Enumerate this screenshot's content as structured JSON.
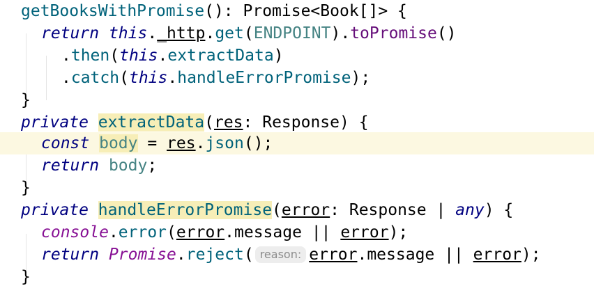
{
  "editor": {
    "lines": [
      {
        "tokens": [
          {
            "text": "getBooksWithPromise",
            "cls": "fn"
          },
          {
            "text": "(): Promise<Book[]> {",
            "cls": "plain"
          }
        ]
      },
      {
        "tokens": [
          {
            "text": "return",
            "cls": "kw"
          },
          {
            "text": " ",
            "cls": "plain"
          },
          {
            "text": "this",
            "cls": "kw"
          },
          {
            "text": ".",
            "cls": "plain"
          },
          {
            "text": "_http",
            "cls": "prop-under"
          },
          {
            "text": ".",
            "cls": "plain"
          },
          {
            "text": "get",
            "cls": "method"
          },
          {
            "text": "(",
            "cls": "plain"
          },
          {
            "text": "ENDPOINT",
            "cls": "const-name"
          },
          {
            "text": ").",
            "cls": "plain"
          },
          {
            "text": "toPromise",
            "cls": "prop"
          },
          {
            "text": "()",
            "cls": "plain"
          }
        ]
      },
      {
        "tokens": [
          {
            "text": ".",
            "cls": "plain"
          },
          {
            "text": "then",
            "cls": "method"
          },
          {
            "text": "(",
            "cls": "plain"
          },
          {
            "text": "this",
            "cls": "kw"
          },
          {
            "text": ".",
            "cls": "plain"
          },
          {
            "text": "extractData",
            "cls": "method"
          },
          {
            "text": ")",
            "cls": "plain"
          }
        ]
      },
      {
        "tokens": [
          {
            "text": ".",
            "cls": "plain"
          },
          {
            "text": "catch",
            "cls": "method"
          },
          {
            "text": "(",
            "cls": "plain"
          },
          {
            "text": "this",
            "cls": "kw"
          },
          {
            "text": ".",
            "cls": "plain"
          },
          {
            "text": "handleErrorPromise",
            "cls": "method"
          },
          {
            "text": ");",
            "cls": "plain"
          }
        ]
      },
      {
        "tokens": [
          {
            "text": "}",
            "cls": "plain"
          }
        ]
      },
      {
        "tokens": [
          {
            "text": "private",
            "cls": "kw"
          },
          {
            "text": " ",
            "cls": "plain"
          },
          {
            "text": "extractData",
            "cls": "fn-decl"
          },
          {
            "text": "(",
            "cls": "plain"
          },
          {
            "text": "res",
            "cls": "param"
          },
          {
            "text": ": Response) {",
            "cls": "plain"
          }
        ]
      },
      {
        "tokens": [
          {
            "text": "const",
            "cls": "kw"
          },
          {
            "text": " ",
            "cls": "plain"
          },
          {
            "text": "body",
            "cls": "localvar-decl"
          },
          {
            "text": " = ",
            "cls": "plain"
          },
          {
            "text": "res",
            "cls": "param"
          },
          {
            "text": ".",
            "cls": "plain"
          },
          {
            "text": "json",
            "cls": "method"
          },
          {
            "text": "();",
            "cls": "plain"
          }
        ]
      },
      {
        "tokens": [
          {
            "text": "return",
            "cls": "kw"
          },
          {
            "text": " ",
            "cls": "plain"
          },
          {
            "text": "body",
            "cls": "localvar"
          },
          {
            "text": ";",
            "cls": "plain"
          }
        ]
      },
      {
        "tokens": [
          {
            "text": "}",
            "cls": "plain"
          }
        ]
      },
      {
        "tokens": [
          {
            "text": "private",
            "cls": "kw"
          },
          {
            "text": " ",
            "cls": "plain"
          },
          {
            "text": "handleErrorPromise",
            "cls": "fn-decl"
          },
          {
            "text": "(",
            "cls": "plain"
          },
          {
            "text": "error",
            "cls": "param"
          },
          {
            "text": ": Response | ",
            "cls": "plain"
          },
          {
            "text": "any",
            "cls": "kw"
          },
          {
            "text": ") {",
            "cls": "plain"
          }
        ]
      },
      {
        "tokens": [
          {
            "text": "console",
            "cls": "console-kw"
          },
          {
            "text": ".",
            "cls": "plain"
          },
          {
            "text": "error",
            "cls": "method"
          },
          {
            "text": "(",
            "cls": "plain"
          },
          {
            "text": "error",
            "cls": "param"
          },
          {
            "text": ".message || ",
            "cls": "plain"
          },
          {
            "text": "error",
            "cls": "param"
          },
          {
            "text": ");",
            "cls": "plain"
          }
        ]
      },
      {
        "tokens": [
          {
            "text": "return",
            "cls": "kw"
          },
          {
            "text": " ",
            "cls": "plain"
          },
          {
            "text": "Promise",
            "cls": "promise-type"
          },
          {
            "text": ".",
            "cls": "plain"
          },
          {
            "text": "reject",
            "cls": "method"
          },
          {
            "text": "(",
            "cls": "plain"
          },
          {
            "text": "reason:",
            "cls": "hint"
          },
          {
            "text": "error",
            "cls": "param"
          },
          {
            "text": ".message || ",
            "cls": "plain"
          },
          {
            "text": "error",
            "cls": "param"
          },
          {
            "text": ");",
            "cls": "plain"
          }
        ]
      },
      {
        "tokens": [
          {
            "text": "}",
            "cls": "plain"
          }
        ]
      }
    ],
    "current_line_index": 6,
    "colors": {
      "background": "#ffffff",
      "current_line": "#fcf8e1",
      "declaration_highlight": "#f7eeb7",
      "keyword": "#000080",
      "method": "#00627a",
      "constant": "#458383",
      "hint_background": "#ededed",
      "hint_text": "#8c8c8c"
    }
  }
}
